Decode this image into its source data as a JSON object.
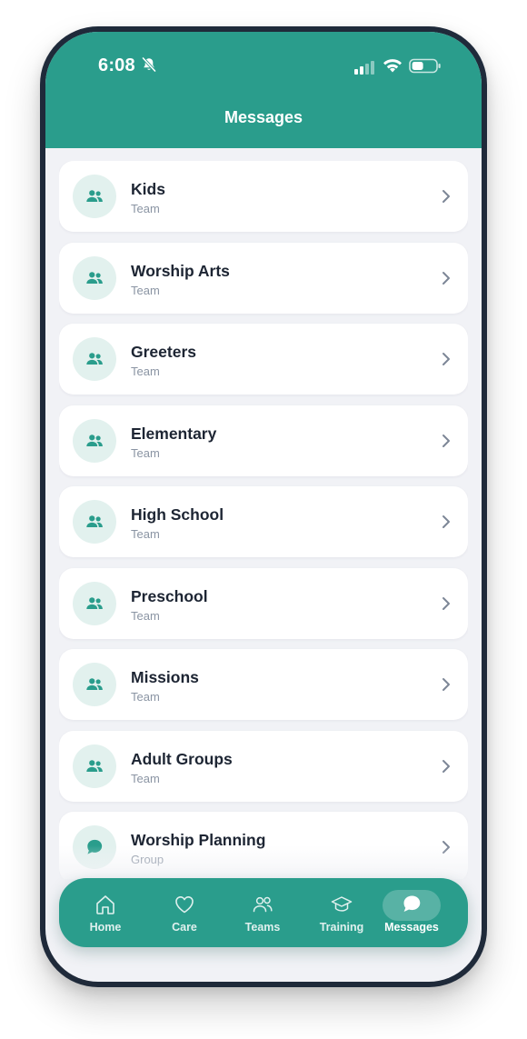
{
  "status_bar": {
    "time": "6:08"
  },
  "header": {
    "title": "Messages"
  },
  "conversations": [
    {
      "name": "Kids",
      "type": "Team",
      "icon": "team-icon"
    },
    {
      "name": "Worship Arts",
      "type": "Team",
      "icon": "team-icon"
    },
    {
      "name": "Greeters",
      "type": "Team",
      "icon": "team-icon"
    },
    {
      "name": "Elementary",
      "type": "Team",
      "icon": "team-icon"
    },
    {
      "name": "High School",
      "type": "Team",
      "icon": "team-icon"
    },
    {
      "name": "Preschool",
      "type": "Team",
      "icon": "team-icon"
    },
    {
      "name": "Missions",
      "type": "Team",
      "icon": "team-icon"
    },
    {
      "name": "Adult Groups",
      "type": "Team",
      "icon": "team-icon"
    },
    {
      "name": "Worship Planning",
      "type": "Group",
      "icon": "chat-bubble-icon"
    }
  ],
  "tab_bar": {
    "tabs": [
      {
        "label": "Home",
        "icon": "home-icon"
      },
      {
        "label": "Care",
        "icon": "heart-icon"
      },
      {
        "label": "Teams",
        "icon": "people-icon"
      },
      {
        "label": "Training",
        "icon": "graduation-cap-icon"
      },
      {
        "label": "Messages",
        "icon": "chat-bubble-icon",
        "active": true
      }
    ]
  },
  "colors": {
    "brand": "#2a9d8c",
    "avatar_bg": "#e2f1ee",
    "background": "#f1f2f6",
    "title_text": "#1d2533",
    "subtitle_text": "#8a94a3"
  }
}
